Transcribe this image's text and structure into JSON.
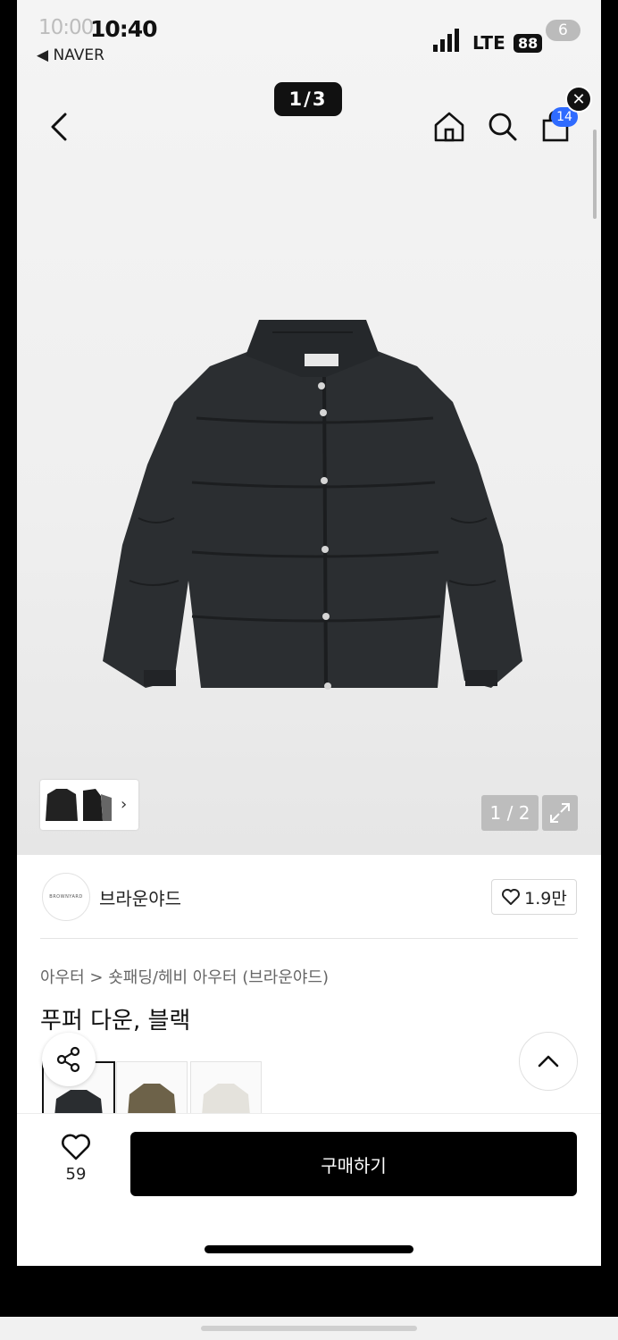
{
  "status_bar": {
    "time": "10:40",
    "time_ghost": "10:00",
    "back_app": "◀ NAVER",
    "network": "LTE",
    "battery": "88",
    "notification_count": "6"
  },
  "header": {
    "image_counter": "1/3",
    "cart_count": "14",
    "close_label": "✕"
  },
  "gallery": {
    "pager": "1 / 2",
    "thumb_arrow": "›"
  },
  "brand": {
    "logo_text": "BROWNYARD",
    "name": "브라운야드",
    "likes": "1.9만"
  },
  "product": {
    "breadcrumb": "아우터 > 숏패딩/헤비 아우터 (브라운야드)",
    "title": "푸퍼 다운, 블랙",
    "colors": [
      {
        "name": "black",
        "swatch": "#2a2d30"
      },
      {
        "name": "khaki",
        "swatch": "#6d6249"
      },
      {
        "name": "ivory",
        "swatch": "#e4e2dc"
      }
    ]
  },
  "bottom_bar": {
    "wish_count": "59",
    "buy_label": "구매하기"
  },
  "colors": {
    "jacket": "#2b2e31",
    "accent_blue": "#2f6bff"
  }
}
